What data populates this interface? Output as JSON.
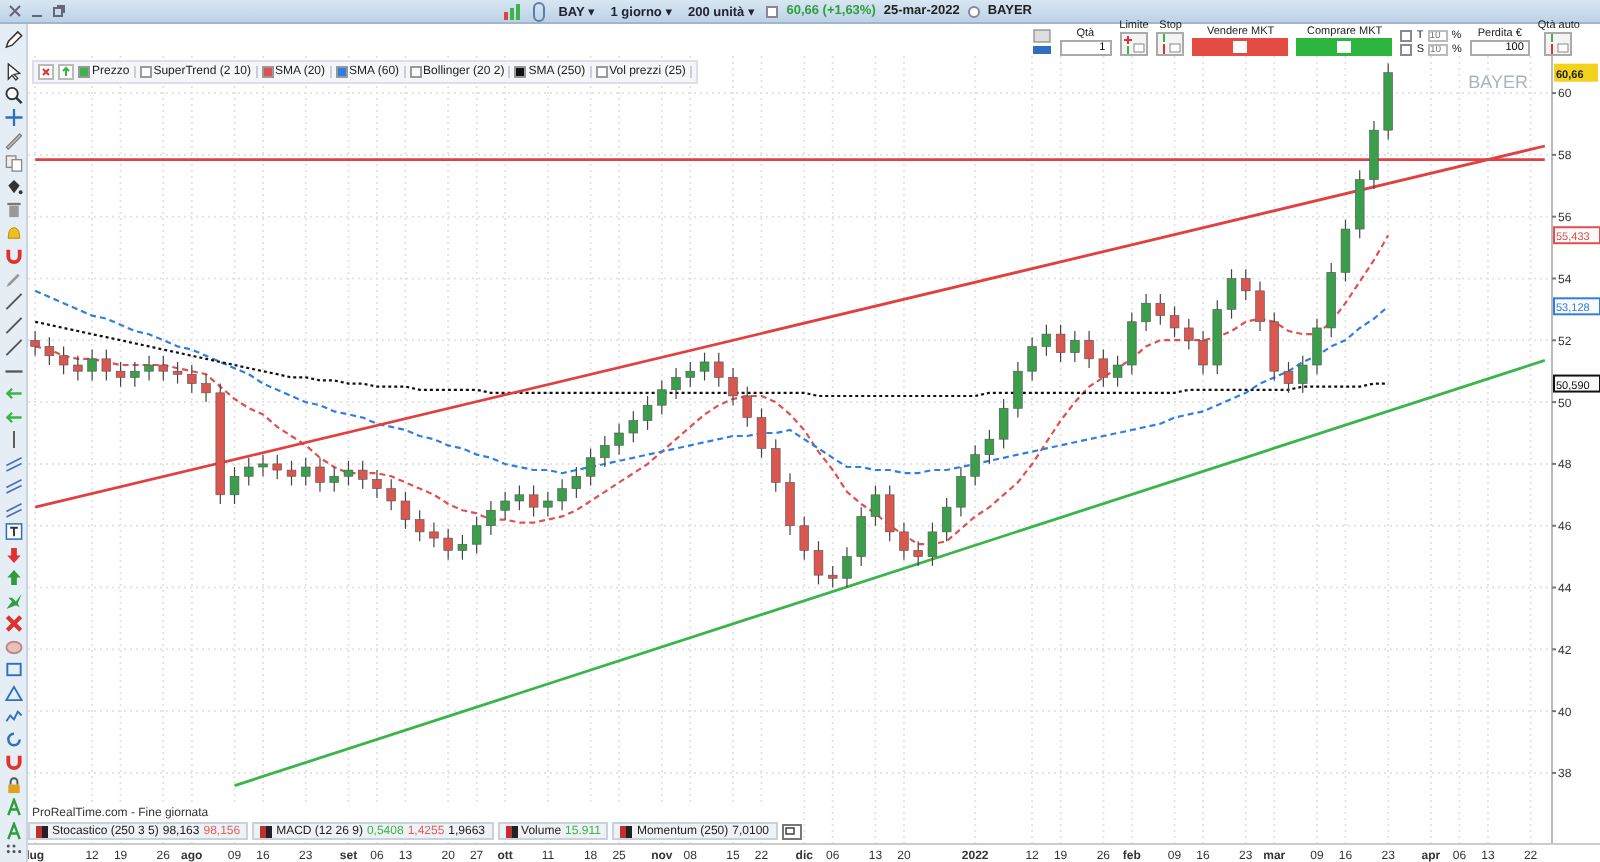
{
  "toolbar": {
    "symbol": "BAY ▾",
    "period": "1 giorno ▾",
    "units": "200 unità ▾",
    "quote_checked": false,
    "quote": "60,66 (+1,63%)",
    "date": "25-mar-2022",
    "name_selected": false,
    "name": "BAYER"
  },
  "order_panel": {
    "qty_label": "Qtà",
    "qty": "1",
    "limit_label": "Limite",
    "stop_label": "Stop",
    "sell": "Vendere MKT",
    "buy": "Comprare MKT",
    "t_checked": false,
    "t_label": "T",
    "t_placeholder": "10",
    "t_unit": "%",
    "s_checked": false,
    "s_label": "S",
    "s_placeholder": "10",
    "s_unit": "%",
    "loss_label": "Perdita €",
    "loss": "100",
    "auto_label": "Qtà auto"
  },
  "chart_legend": [
    {
      "kind": "label",
      "label": "Prezzo",
      "checked": true,
      "color": "#3bb44a"
    },
    {
      "kind": "label",
      "label": "SuperTrend (2 10)",
      "checked": false
    },
    {
      "kind": "series",
      "checked": true
    },
    {
      "kind": "series",
      "checked": true
    },
    {
      "kind": "label",
      "label": "Bollinger (20 2)",
      "checked": false
    },
    {
      "kind": "series",
      "checked": true
    },
    {
      "kind": "label",
      "label": "Vol prezzi (25)",
      "checked": false
    }
  ],
  "chart": {
    "chart_data": {
      "type": "candlestick",
      "title": "BAYER",
      "grid": true,
      "categories": [
        "lug",
        null,
        null,
        null,
        "12",
        null,
        "19",
        null,
        null,
        "26",
        null,
        "ago",
        null,
        null,
        "09",
        null,
        "16",
        null,
        null,
        "23",
        null,
        null,
        "set",
        null,
        "06",
        null,
        "13",
        null,
        null,
        "20",
        null,
        "27",
        null,
        "ott",
        null,
        null,
        "11",
        null,
        null,
        "18",
        null,
        "25",
        null,
        null,
        "nov",
        null,
        "08",
        null,
        null,
        "15",
        null,
        "22",
        null,
        null,
        "dic",
        null,
        "06",
        null,
        null,
        "13",
        null,
        "20",
        null,
        null,
        null,
        null,
        "2022",
        null,
        null,
        null,
        "12",
        null,
        "19",
        null,
        null,
        "26",
        null,
        "feb",
        null,
        null,
        "09",
        null,
        "16",
        null,
        null,
        "23",
        null,
        "mar",
        null,
        null,
        "09",
        null,
        "16",
        null,
        null,
        "23",
        null,
        null,
        "apr",
        null,
        "06",
        null,
        "13",
        null,
        null,
        "22",
        null
      ],
      "ylim": [
        35.7,
        61.2
      ],
      "yticks": [
        38,
        40,
        42,
        44,
        46,
        48,
        50,
        52,
        54,
        56,
        58,
        60
      ],
      "ohlc": [
        [
          52.0,
          52.3,
          51.5,
          51.8
        ],
        [
          51.8,
          52.1,
          51.2,
          51.5
        ],
        [
          51.5,
          51.8,
          50.9,
          51.2
        ],
        [
          51.2,
          51.5,
          50.7,
          51.0
        ],
        [
          51.0,
          51.7,
          50.7,
          51.4
        ],
        [
          51.4,
          51.7,
          50.7,
          51.0
        ],
        [
          51.0,
          51.3,
          50.5,
          50.8
        ],
        [
          50.8,
          51.3,
          50.5,
          51.0
        ],
        [
          51.0,
          51.5,
          50.7,
          51.2
        ],
        [
          51.2,
          51.5,
          50.7,
          51.0
        ],
        [
          51.0,
          51.3,
          50.6,
          50.9
        ],
        [
          50.9,
          51.2,
          50.3,
          50.6
        ],
        [
          50.6,
          50.9,
          50.0,
          50.3
        ],
        [
          50.3,
          50.6,
          46.7,
          47.0
        ],
        [
          47.0,
          47.9,
          46.7,
          47.6
        ],
        [
          47.6,
          48.2,
          47.3,
          47.9
        ],
        [
          47.9,
          48.3,
          47.6,
          48.0
        ],
        [
          48.0,
          48.3,
          47.5,
          47.8
        ],
        [
          47.8,
          48.1,
          47.3,
          47.6
        ],
        [
          47.6,
          48.2,
          47.3,
          47.9
        ],
        [
          47.9,
          48.2,
          47.1,
          47.4
        ],
        [
          47.4,
          47.9,
          47.1,
          47.6
        ],
        [
          47.6,
          48.1,
          47.3,
          47.8
        ],
        [
          47.8,
          48.1,
          47.2,
          47.5
        ],
        [
          47.5,
          47.8,
          46.9,
          47.2
        ],
        [
          47.2,
          47.5,
          46.5,
          46.8
        ],
        [
          46.8,
          47.1,
          45.9,
          46.2
        ],
        [
          46.2,
          46.5,
          45.5,
          45.8
        ],
        [
          45.8,
          46.1,
          45.3,
          45.6
        ],
        [
          45.6,
          45.9,
          44.9,
          45.2
        ],
        [
          45.2,
          45.7,
          44.9,
          45.4
        ],
        [
          45.4,
          46.3,
          45.1,
          46.0
        ],
        [
          46.0,
          46.8,
          45.7,
          46.5
        ],
        [
          46.5,
          47.1,
          46.2,
          46.8
        ],
        [
          46.8,
          47.3,
          46.5,
          47.0
        ],
        [
          47.0,
          47.3,
          46.3,
          46.6
        ],
        [
          46.6,
          47.1,
          46.3,
          46.8
        ],
        [
          46.8,
          47.5,
          46.5,
          47.2
        ],
        [
          47.2,
          47.9,
          46.9,
          47.6
        ],
        [
          47.6,
          48.5,
          47.3,
          48.2
        ],
        [
          48.2,
          48.9,
          47.9,
          48.6
        ],
        [
          48.6,
          49.3,
          48.3,
          49.0
        ],
        [
          49.0,
          49.7,
          48.7,
          49.4
        ],
        [
          49.4,
          50.2,
          49.1,
          49.9
        ],
        [
          49.9,
          50.7,
          49.6,
          50.4
        ],
        [
          50.4,
          51.1,
          50.1,
          50.8
        ],
        [
          50.8,
          51.3,
          50.5,
          51.0
        ],
        [
          51.0,
          51.6,
          50.7,
          51.3
        ],
        [
          51.3,
          51.6,
          50.5,
          50.8
        ],
        [
          50.8,
          51.1,
          49.9,
          50.2
        ],
        [
          50.2,
          50.5,
          49.2,
          49.5
        ],
        [
          49.5,
          49.8,
          48.2,
          48.5
        ],
        [
          48.5,
          48.8,
          47.1,
          47.4
        ],
        [
          47.4,
          47.7,
          45.7,
          46.0
        ],
        [
          46.0,
          46.3,
          44.9,
          45.2
        ],
        [
          45.2,
          45.5,
          44.1,
          44.4
        ],
        [
          44.4,
          44.7,
          44.0,
          44.3
        ],
        [
          44.3,
          45.3,
          44.0,
          45.0
        ],
        [
          45.0,
          46.6,
          44.7,
          46.3
        ],
        [
          46.3,
          47.3,
          46.0,
          47.0
        ],
        [
          47.0,
          47.3,
          45.5,
          45.8
        ],
        [
          45.8,
          46.1,
          44.9,
          45.2
        ],
        [
          45.2,
          45.5,
          44.7,
          45.0
        ],
        [
          45.0,
          46.1,
          44.7,
          45.8
        ],
        [
          45.8,
          46.9,
          45.5,
          46.6
        ],
        [
          46.6,
          47.9,
          46.3,
          47.6
        ],
        [
          47.6,
          48.6,
          47.3,
          48.3
        ],
        [
          48.3,
          49.1,
          48.0,
          48.8
        ],
        [
          48.8,
          50.1,
          48.5,
          49.8
        ],
        [
          49.8,
          51.3,
          49.5,
          51.0
        ],
        [
          51.0,
          52.1,
          50.7,
          51.8
        ],
        [
          51.8,
          52.5,
          51.5,
          52.2
        ],
        [
          52.2,
          52.5,
          51.3,
          51.6
        ],
        [
          51.6,
          52.3,
          51.3,
          52.0
        ],
        [
          52.0,
          52.3,
          51.1,
          51.4
        ],
        [
          51.4,
          51.7,
          50.5,
          50.8
        ],
        [
          50.8,
          51.5,
          50.5,
          51.2
        ],
        [
          51.2,
          52.9,
          50.9,
          52.6
        ],
        [
          52.6,
          53.5,
          52.3,
          53.2
        ],
        [
          53.2,
          53.5,
          52.5,
          52.8
        ],
        [
          52.8,
          53.1,
          52.1,
          52.4
        ],
        [
          52.4,
          52.7,
          51.7,
          52.0
        ],
        [
          52.0,
          52.3,
          50.9,
          51.2
        ],
        [
          51.2,
          53.3,
          50.9,
          53.0
        ],
        [
          53.0,
          54.3,
          52.7,
          54.0
        ],
        [
          54.0,
          54.3,
          53.3,
          53.6
        ],
        [
          53.6,
          53.9,
          52.3,
          52.6
        ],
        [
          52.6,
          52.9,
          50.7,
          51.0
        ],
        [
          51.0,
          51.3,
          50.3,
          50.6
        ],
        [
          50.6,
          51.5,
          50.3,
          51.2
        ],
        [
          51.2,
          52.7,
          50.9,
          52.4
        ],
        [
          52.4,
          54.5,
          52.1,
          54.2
        ],
        [
          54.2,
          55.9,
          53.9,
          55.6
        ],
        [
          55.6,
          57.5,
          55.3,
          57.2
        ],
        [
          57.2,
          59.1,
          56.9,
          58.8
        ],
        [
          58.8,
          60.96,
          58.5,
          60.66
        ],
        null,
        null,
        null,
        null,
        null,
        null,
        null,
        null,
        null,
        null,
        null
      ],
      "series": [
        {
          "name": "SMA (20)",
          "type": "line",
          "color": "#e05050",
          "line_style": "dashed",
          "values": [
            51.8,
            51.7,
            51.5,
            51.4,
            51.4,
            51.3,
            51.2,
            51.2,
            51.2,
            51.2,
            51.1,
            51.0,
            50.9,
            50.5,
            50.1,
            49.8,
            49.6,
            49.2,
            48.9,
            48.6,
            48.2,
            47.9,
            47.7,
            47.7,
            47.7,
            47.6,
            47.4,
            47.2,
            47.0,
            46.7,
            46.5,
            46.4,
            46.2,
            46.2,
            46.1,
            46.1,
            46.2,
            46.3,
            46.5,
            46.8,
            47.1,
            47.4,
            47.7,
            48.0,
            48.4,
            48.8,
            49.2,
            49.6,
            49.9,
            50.1,
            50.2,
            50.2,
            50.0,
            49.6,
            49.1,
            48.4,
            47.8,
            47.1,
            46.7,
            46.4,
            46.0,
            45.7,
            45.4,
            45.4,
            45.5,
            45.9,
            46.3,
            46.6,
            47.0,
            47.4,
            48.0,
            48.7,
            49.4,
            50.0,
            50.5,
            50.8,
            51.1,
            51.4,
            51.8,
            52.0,
            52.0,
            52.0,
            52.0,
            52.1,
            52.3,
            52.6,
            52.7,
            52.6,
            52.3,
            52.2,
            52.2,
            52.6,
            53.2,
            53.9,
            54.6,
            55.4,
            null,
            null,
            null,
            null,
            null,
            null,
            null,
            null,
            null,
            null,
            null
          ]
        },
        {
          "name": "SMA (60)",
          "type": "line",
          "color": "#2f7fe0",
          "line_style": "dashed",
          "values": [
            53.6,
            53.4,
            53.2,
            53.0,
            52.8,
            52.7,
            52.5,
            52.3,
            52.2,
            52.0,
            51.8,
            51.7,
            51.5,
            51.3,
            51.1,
            50.9,
            50.6,
            50.4,
            50.2,
            50.0,
            49.9,
            49.7,
            49.6,
            49.5,
            49.3,
            49.2,
            49.1,
            48.9,
            48.8,
            48.6,
            48.5,
            48.3,
            48.2,
            48.0,
            47.9,
            47.8,
            47.8,
            47.7,
            47.8,
            47.9,
            48.0,
            48.1,
            48.2,
            48.3,
            48.4,
            48.5,
            48.6,
            48.7,
            48.8,
            48.9,
            48.9,
            49.0,
            49.0,
            49.1,
            48.8,
            48.5,
            48.2,
            47.9,
            47.9,
            47.8,
            47.8,
            47.7,
            47.7,
            47.8,
            47.8,
            47.9,
            48.0,
            48.1,
            48.2,
            48.3,
            48.4,
            48.5,
            48.6,
            48.7,
            48.8,
            48.9,
            49.0,
            49.1,
            49.2,
            49.3,
            49.5,
            49.6,
            49.7,
            49.9,
            50.1,
            50.3,
            50.6,
            50.8,
            51.0,
            51.3,
            51.5,
            51.8,
            52.0,
            52.4,
            52.7,
            53.1,
            null,
            null,
            null,
            null,
            null,
            null,
            null,
            null,
            null,
            null,
            null
          ]
        },
        {
          "name": "SMA (250)",
          "type": "line",
          "color": "#111111",
          "line_style": "dotted",
          "values": [
            52.6,
            52.5,
            52.4,
            52.3,
            52.2,
            52.1,
            52.0,
            51.9,
            51.8,
            51.7,
            51.6,
            51.5,
            51.4,
            51.3,
            51.2,
            51.1,
            51.0,
            50.9,
            50.8,
            50.8,
            50.7,
            50.7,
            50.6,
            50.6,
            50.5,
            50.5,
            50.5,
            50.4,
            50.4,
            50.4,
            50.4,
            50.4,
            50.3,
            50.3,
            50.3,
            50.3,
            50.3,
            50.3,
            50.3,
            50.3,
            50.3,
            50.3,
            50.3,
            50.3,
            50.3,
            50.3,
            50.3,
            50.3,
            50.3,
            50.3,
            50.3,
            50.3,
            50.3,
            50.3,
            50.3,
            50.2,
            50.2,
            50.2,
            50.2,
            50.2,
            50.2,
            50.2,
            50.2,
            50.2,
            50.2,
            50.2,
            50.2,
            50.3,
            50.3,
            50.3,
            50.3,
            50.3,
            50.3,
            50.3,
            50.3,
            50.3,
            50.3,
            50.3,
            50.3,
            50.3,
            50.3,
            50.4,
            50.4,
            50.4,
            50.4,
            50.4,
            50.4,
            50.4,
            50.4,
            50.5,
            50.5,
            50.5,
            50.5,
            50.5,
            50.6,
            50.6,
            null,
            null,
            null,
            null,
            null,
            null,
            null,
            null,
            null,
            null,
            null
          ]
        },
        {
          "type": "line",
          "color": "#e04040",
          "line_style": "solid",
          "values": [
            46.6,
            null,
            null,
            null,
            null,
            null,
            null,
            null,
            null,
            null,
            null,
            null,
            null,
            null,
            null,
            null,
            null,
            null,
            null,
            null,
            null,
            null,
            null,
            null,
            null,
            null,
            null,
            null,
            null,
            null,
            null,
            null,
            null,
            null,
            null,
            null,
            null,
            null,
            null,
            null,
            null,
            null,
            null,
            null,
            null,
            null,
            null,
            null,
            null,
            null,
            null,
            null,
            null,
            null,
            null,
            null,
            null,
            null,
            null,
            null,
            null,
            null,
            null,
            null,
            null,
            null,
            null,
            null,
            null,
            null,
            null,
            null,
            null,
            null,
            null,
            null,
            null,
            null,
            null,
            null,
            null,
            null,
            null,
            null,
            null,
            null,
            null,
            null,
            null,
            null,
            null,
            null,
            null,
            null,
            null,
            null,
            null,
            null,
            null,
            null,
            null,
            null,
            null,
            null,
            null,
            null,
            58.29
          ]
        },
        {
          "type": "line",
          "color": "#e04040",
          "line_style": "solid",
          "values": [
            57.85,
            null,
            null,
            null,
            null,
            null,
            null,
            null,
            null,
            null,
            null,
            null,
            null,
            null,
            null,
            null,
            null,
            null,
            null,
            null,
            null,
            null,
            null,
            null,
            null,
            null,
            null,
            null,
            null,
            null,
            null,
            null,
            null,
            null,
            null,
            null,
            null,
            null,
            null,
            null,
            null,
            null,
            null,
            null,
            null,
            null,
            null,
            null,
            null,
            null,
            null,
            null,
            null,
            null,
            null,
            null,
            null,
            null,
            null,
            null,
            null,
            null,
            null,
            null,
            null,
            null,
            null,
            null,
            null,
            null,
            null,
            null,
            null,
            null,
            null,
            null,
            null,
            null,
            null,
            null,
            null,
            null,
            null,
            null,
            null,
            null,
            null,
            null,
            null,
            null,
            null,
            null,
            null,
            null,
            null,
            null,
            null,
            null,
            null,
            null,
            null,
            null,
            null,
            null,
            null,
            null,
            57.85
          ]
        },
        {
          "type": "line",
          "color": "#3bb44a",
          "line_style": "solid",
          "values": [
            null,
            null,
            null,
            null,
            null,
            null,
            null,
            null,
            null,
            null,
            null,
            null,
            null,
            null,
            37.59,
            null,
            null,
            null,
            null,
            null,
            null,
            null,
            null,
            null,
            null,
            null,
            null,
            null,
            null,
            null,
            null,
            null,
            null,
            null,
            null,
            null,
            null,
            null,
            null,
            null,
            null,
            null,
            null,
            null,
            null,
            null,
            null,
            null,
            null,
            null,
            null,
            null,
            null,
            null,
            null,
            null,
            null,
            null,
            null,
            null,
            null,
            null,
            null,
            null,
            null,
            null,
            null,
            null,
            null,
            null,
            null,
            null,
            null,
            null,
            null,
            null,
            null,
            null,
            null,
            null,
            null,
            null,
            null,
            null,
            null,
            null,
            null,
            null,
            null,
            null,
            null,
            null,
            null,
            null,
            null,
            null,
            null,
            null,
            null,
            null,
            null,
            null,
            null,
            null,
            null,
            null,
            51.35
          ]
        }
      ]
    },
    "last_values": [
      {
        "text": "60,66",
        "color": "#f2d21b"
      },
      {
        "text": "55,433",
        "color": "#e05050"
      },
      {
        "text": "53,128",
        "color": "#2f7fe0"
      },
      {
        "text": "50,590",
        "color": "#111111"
      }
    ],
    "footer_note": "ProRealTime.com - Fine giornata",
    "indicators": [
      {
        "label": "Stocastico (250 3 5)",
        "values": [
          {
            "text": "98,163",
            "color": "#222222"
          },
          {
            "text": "98,156",
            "color": "#e06060"
          }
        ]
      },
      {
        "label": "MACD (12 26 9)",
        "values": [
          {
            "text": "0,5408",
            "color": "#3bb44a"
          },
          {
            "text": "1,4255",
            "color": "#e06060"
          },
          {
            "text": "1,9663",
            "color": "#222222"
          }
        ]
      },
      {
        "label": "Volume",
        "values": [
          {
            "text": "15.911",
            "color": "#3bb44a"
          }
        ]
      },
      {
        "label": "Momentum (250)",
        "values": [
          {
            "text": "7,0100",
            "color": "#222222"
          }
        ]
      }
    ]
  }
}
